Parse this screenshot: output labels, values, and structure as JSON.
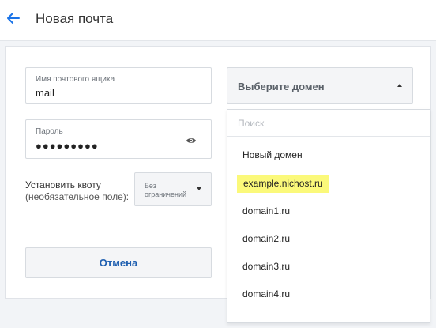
{
  "header": {
    "back_icon": "arrow-left-icon",
    "title": "Новая почта",
    "accent_color": "#1a73e8"
  },
  "form": {
    "mailbox": {
      "label": "Имя почтового ящика",
      "value": "mail"
    },
    "password": {
      "label": "Пароль",
      "value": "●●●●●●●●●",
      "toggle_icon": "eye-icon"
    },
    "quota": {
      "label": "Установить квоту",
      "hint": "(необязательное поле):",
      "selected_line1": "Без",
      "selected_line2": "ограничений"
    },
    "domain": {
      "placeholder": "Выберите домен",
      "search_placeholder": "Поиск",
      "options": [
        {
          "label": "Новый домен"
        },
        {
          "label": "example.nichost.ru",
          "highlighted": true
        },
        {
          "label": "domain1.ru"
        },
        {
          "label": "domain2.ru"
        },
        {
          "label": "domain3.ru"
        },
        {
          "label": "domain4.ru"
        }
      ]
    },
    "cancel_label": "Отмена"
  }
}
